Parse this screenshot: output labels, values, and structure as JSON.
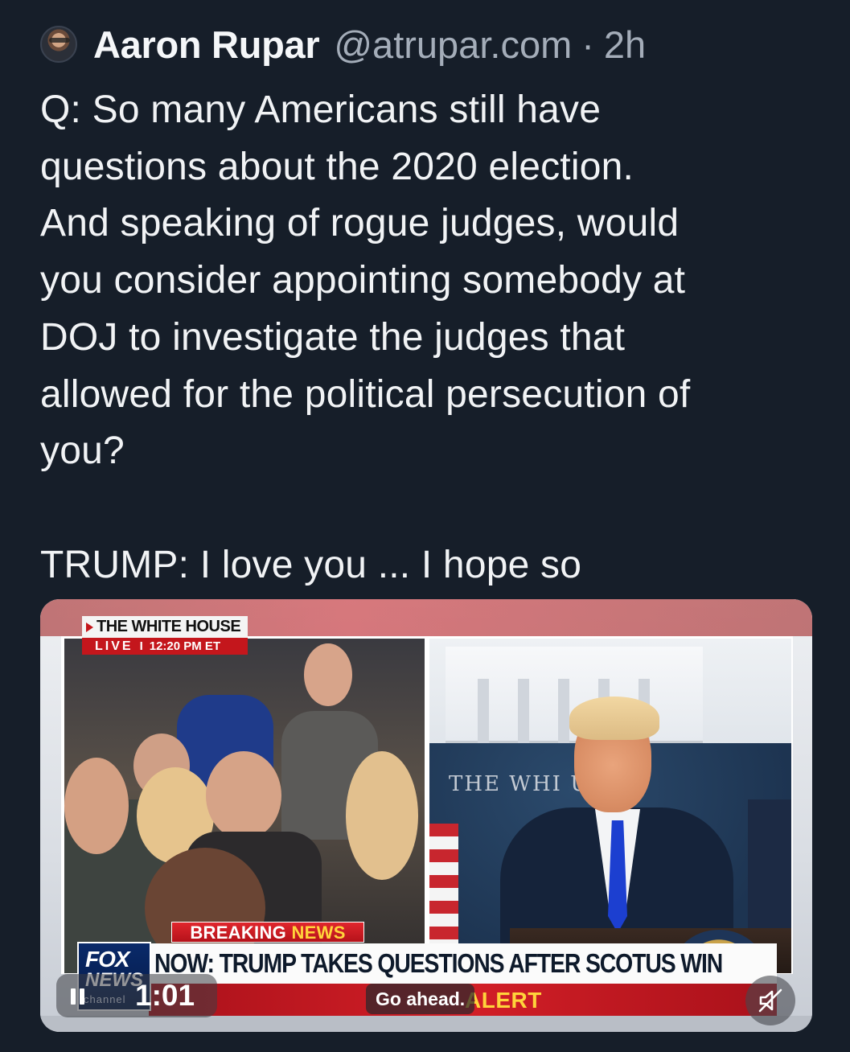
{
  "post": {
    "author": "Aaron Rupar",
    "handle": "@atrupar.com",
    "separator": "·",
    "time": "2h",
    "lines": [
      "Q: So many Americans still have",
      "questions about the 2020 election.",
      "And speaking of rogue judges, would",
      "you consider appointing somebody at",
      "DOJ to investigate the judges that",
      "allowed for the political persecution of",
      "you?"
    ],
    "reply": "TRUMP: I love you ... I hope so"
  },
  "video": {
    "location": "THE WHITE HOUSE",
    "live": "LIVE",
    "live_time": "12:20 PM ET",
    "backdrop_text": "THE WHI   USE",
    "breaking_word": "BREAKING ",
    "breaking_news": "NEWS",
    "headline": "NOW: TRUMP TAKES QUESTIONS AFTER SCOTUS WIN",
    "alert": "ALERT",
    "logo_line1": "FOX",
    "logo_line2": "NEWS",
    "logo_line3": "channel",
    "elapsed": "1:01",
    "caption": "Go ahead."
  },
  "colors": {
    "background": "#161e29",
    "fox_red": "#c4161c",
    "alert_yellow": "#ffd43b"
  },
  "icons": [
    "avatar",
    "pause-icon",
    "mute-icon"
  ]
}
